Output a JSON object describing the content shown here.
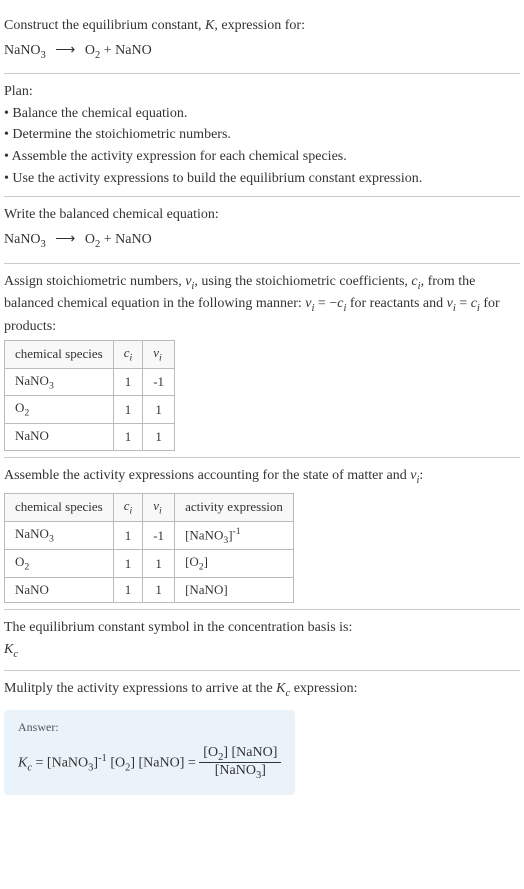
{
  "header": {
    "prompt_line1": "Construct the equilibrium constant, ",
    "K": "K",
    "prompt_line1_after": ", expression for:",
    "equation_lhs": "NaNO",
    "equation_lhs_sub": "3",
    "arrow": "⟶",
    "equation_rhs_1": "O",
    "equation_rhs_1_sub": "2",
    "plus": " + ",
    "equation_rhs_2": "NaNO"
  },
  "plan": {
    "title": "Plan:",
    "items": [
      "• Balance the chemical equation.",
      "• Determine the stoichiometric numbers.",
      "• Assemble the activity expression for each chemical species.",
      "• Use the activity expressions to build the equilibrium constant expression."
    ]
  },
  "balanced": {
    "intro": "Write the balanced chemical equation:",
    "lhs": "NaNO",
    "lhs_sub": "3",
    "arrow": "⟶",
    "rhs_1": "O",
    "rhs_1_sub": "2",
    "plus": " + ",
    "rhs_2": "NaNO"
  },
  "stoich": {
    "intro_1": "Assign stoichiometric numbers, ",
    "nu_i": "ν",
    "nu_i_sub": "i",
    "intro_2": ", using the stoichiometric coefficients, ",
    "c_i": "c",
    "c_i_sub": "i",
    "intro_3": ", from the balanced chemical equation in the following manner: ",
    "rel1_lhs": "ν",
    "rel1_lhs_sub": "i",
    "rel1_eq": " = −",
    "rel1_rhs": "c",
    "rel1_rhs_sub": "i",
    "rel1_after": " for reactants and ",
    "rel2_lhs": "ν",
    "rel2_lhs_sub": "i",
    "rel2_eq": " = ",
    "rel2_rhs": "c",
    "rel2_rhs_sub": "i",
    "rel2_after": " for products:",
    "headers": {
      "species": "chemical species",
      "ci": "c",
      "ci_sub": "i",
      "nui": "ν",
      "nui_sub": "i"
    },
    "rows": [
      {
        "species": "NaNO",
        "species_sub": "3",
        "ci": "1",
        "nui": "-1"
      },
      {
        "species": "O",
        "species_sub": "2",
        "ci": "1",
        "nui": "1"
      },
      {
        "species": "NaNO",
        "species_sub": "",
        "ci": "1",
        "nui": "1"
      }
    ]
  },
  "activity": {
    "intro_1": "Assemble the activity expressions accounting for the state of matter and ",
    "nu_i": "ν",
    "nu_i_sub": "i",
    "intro_2": ":",
    "headers": {
      "species": "chemical species",
      "ci": "c",
      "ci_sub": "i",
      "nui": "ν",
      "nui_sub": "i",
      "activity": "activity expression"
    },
    "rows": [
      {
        "species": "NaNO",
        "species_sub": "3",
        "ci": "1",
        "nui": "-1",
        "act_bracket": "[NaNO",
        "act_sub": "3",
        "act_close": "]",
        "act_exp": "-1"
      },
      {
        "species": "O",
        "species_sub": "2",
        "ci": "1",
        "nui": "1",
        "act_bracket": "[O",
        "act_sub": "2",
        "act_close": "]",
        "act_exp": ""
      },
      {
        "species": "NaNO",
        "species_sub": "",
        "ci": "1",
        "nui": "1",
        "act_bracket": "[NaNO]",
        "act_sub": "",
        "act_close": "",
        "act_exp": ""
      }
    ]
  },
  "symbol": {
    "intro": "The equilibrium constant symbol in the concentration basis is:",
    "K": "K",
    "K_sub": "c"
  },
  "multiply": {
    "intro_1": "Mulitply the activity expressions to arrive at the ",
    "K": "K",
    "K_sub": "c",
    "intro_2": " expression:"
  },
  "answer": {
    "label": "Answer:",
    "K": "K",
    "K_sub": "c",
    "eq": " = ",
    "term1": "[NaNO",
    "term1_sub": "3",
    "term1_close": "]",
    "term1_exp": "-1",
    "space1": " ",
    "term2": "[O",
    "term2_sub": "2",
    "term2_close": "]",
    "space2": " ",
    "term3": "[NaNO]",
    "eq2": " = ",
    "num_1": "[O",
    "num_1_sub": "2",
    "num_1_close": "] [NaNO]",
    "den": "[NaNO",
    "den_sub": "3",
    "den_close": "]"
  }
}
